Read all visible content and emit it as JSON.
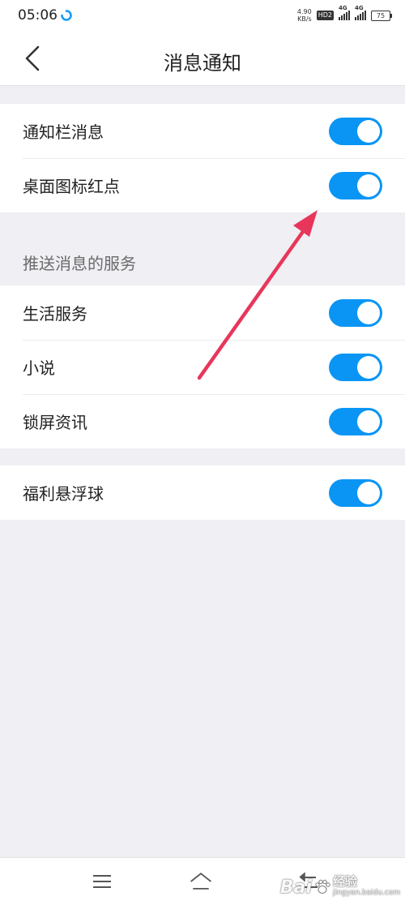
{
  "status_bar": {
    "time": "05:06",
    "speed_value": "4.90",
    "speed_unit": "KB/s",
    "hd_label": "HD2",
    "network_1": "4G",
    "network_2": "4G",
    "battery": "75"
  },
  "header": {
    "title": "消息通知"
  },
  "group_1": {
    "items": [
      {
        "label": "通知栏消息",
        "enabled": true
      },
      {
        "label": "桌面图标红点",
        "enabled": true
      }
    ]
  },
  "push_section": {
    "header": "推送消息的服务",
    "items": [
      {
        "label": "生活服务",
        "enabled": true
      },
      {
        "label": "小说",
        "enabled": true
      },
      {
        "label": "锁屏资讯",
        "enabled": true
      }
    ]
  },
  "group_3": {
    "items": [
      {
        "label": "福利悬浮球",
        "enabled": true
      }
    ]
  },
  "watermark": {
    "brand": "Bai",
    "brand_cn": "经验",
    "url": "jingyan.baidu.com"
  },
  "colors": {
    "toggle_on": "#0a95f5",
    "annotation_arrow": "#e8365a",
    "background": "#efeff4"
  }
}
